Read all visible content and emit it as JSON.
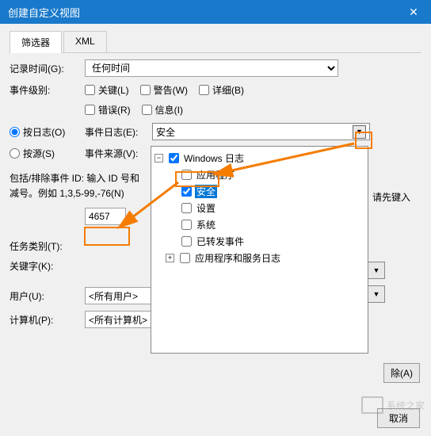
{
  "window": {
    "title": "创建自定义视图",
    "close": "✕"
  },
  "tabs": {
    "filter": "筛选器",
    "xml": "XML"
  },
  "labels": {
    "logTime": "记录时间(G):",
    "eventLevel": "事件级别:",
    "byLog": "按日志(O)",
    "bySource": "按源(S)",
    "eventLog": "事件日志(E):",
    "eventSource": "事件来源(V):",
    "includeExcludeDesc1": "包括/排除事件 ID: 输入 ID 号和",
    "includeExcludeDesc2": "减号。例如 1,3,5-99,-76(N)",
    "taskCategory": "任务类别(T):",
    "keyword": "关键字(K):",
    "user": "用户(U):",
    "computer": "计算机(P):",
    "hintSuffix": "请先键入"
  },
  "values": {
    "logTime": "任何时间",
    "eventLog": "安全",
    "idInput": "4657",
    "user": "<所有用户>",
    "computer": "<所有计算机>"
  },
  "checkboxes": {
    "critical": "关键(L)",
    "warning": "警告(W)",
    "verbose": "详细(B)",
    "error": "错误(R)",
    "info": "信息(I)"
  },
  "tree": {
    "root": "Windows 日志",
    "items": {
      "application": "应用程序",
      "security": "安全",
      "setup": "设置",
      "system": "系统",
      "forwarded": "已转发事件",
      "appsServices": "应用程序和服务日志"
    }
  },
  "buttons": {
    "clear": "除(A)",
    "cancel": "取消"
  },
  "dropdownArrow": "▼",
  "treeExpand": "−",
  "treeCollapse": "+"
}
